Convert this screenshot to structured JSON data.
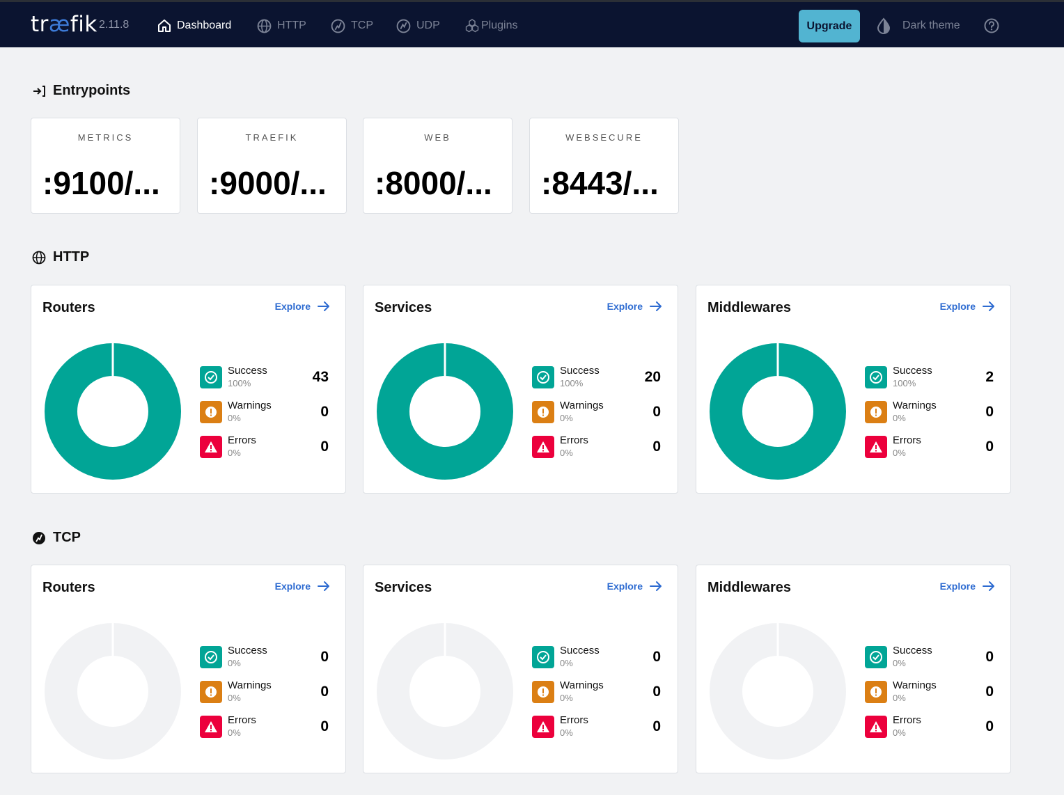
{
  "header": {
    "logo_prefix": "tr",
    "logo_ae": "æ",
    "logo_suffix": "fik",
    "version": "2.11.8",
    "nav": [
      {
        "label": "Dashboard",
        "icon": "home-icon",
        "active": true
      },
      {
        "label": "HTTP",
        "icon": "globe-icon",
        "active": false
      },
      {
        "label": "TCP",
        "icon": "tcp-icon",
        "active": false
      },
      {
        "label": "UDP",
        "icon": "udp-icon",
        "active": false
      },
      {
        "label": "Plugins",
        "icon": "plugins-icon",
        "active": false
      }
    ],
    "upgrade_label": "Upgrade",
    "theme_label": "Dark theme",
    "help_icon": "help-icon"
  },
  "entrypoints": {
    "title": "Entrypoints",
    "items": [
      {
        "name": "METRICS",
        "address": ":9100/..."
      },
      {
        "name": "TRAEFIK",
        "address": ":9000/..."
      },
      {
        "name": "WEB",
        "address": ":8000/..."
      },
      {
        "name": "WEBSECURE",
        "address": ":8443/..."
      }
    ]
  },
  "http": {
    "title": "HTTP",
    "panels": [
      {
        "title": "Routers",
        "explore": "Explore",
        "success": {
          "label": "Success",
          "pct": "100%",
          "count": "43"
        },
        "warnings": {
          "label": "Warnings",
          "pct": "0%",
          "count": "0"
        },
        "errors": {
          "label": "Errors",
          "pct": "0%",
          "count": "0"
        }
      },
      {
        "title": "Services",
        "explore": "Explore",
        "success": {
          "label": "Success",
          "pct": "100%",
          "count": "20"
        },
        "warnings": {
          "label": "Warnings",
          "pct": "0%",
          "count": "0"
        },
        "errors": {
          "label": "Errors",
          "pct": "0%",
          "count": "0"
        }
      },
      {
        "title": "Middlewares",
        "explore": "Explore",
        "success": {
          "label": "Success",
          "pct": "100%",
          "count": "2"
        },
        "warnings": {
          "label": "Warnings",
          "pct": "0%",
          "count": "0"
        },
        "errors": {
          "label": "Errors",
          "pct": "0%",
          "count": "0"
        }
      }
    ]
  },
  "tcp": {
    "title": "TCP",
    "panels": [
      {
        "title": "Routers",
        "explore": "Explore",
        "success": {
          "label": "Success",
          "pct": "0%",
          "count": "0"
        },
        "warnings": {
          "label": "Warnings",
          "pct": "0%",
          "count": "0"
        },
        "errors": {
          "label": "Errors",
          "pct": "0%",
          "count": "0"
        }
      },
      {
        "title": "Services",
        "explore": "Explore",
        "success": {
          "label": "Success",
          "pct": "0%",
          "count": "0"
        },
        "warnings": {
          "label": "Warnings",
          "pct": "0%",
          "count": "0"
        },
        "errors": {
          "label": "Errors",
          "pct": "0%",
          "count": "0"
        }
      },
      {
        "title": "Middlewares",
        "explore": "Explore",
        "success": {
          "label": "Success",
          "pct": "0%",
          "count": "0"
        },
        "warnings": {
          "label": "Warnings",
          "pct": "0%",
          "count": "0"
        },
        "errors": {
          "label": "Errors",
          "pct": "0%",
          "count": "0"
        }
      }
    ]
  },
  "colors": {
    "success": "#01a596",
    "warning": "#db7f14",
    "error": "#ec003c",
    "empty": "#f1f2f4",
    "nav_bg": "#0b1430",
    "upgrade_bg": "#52b4d1",
    "link": "#2d6bd1"
  }
}
